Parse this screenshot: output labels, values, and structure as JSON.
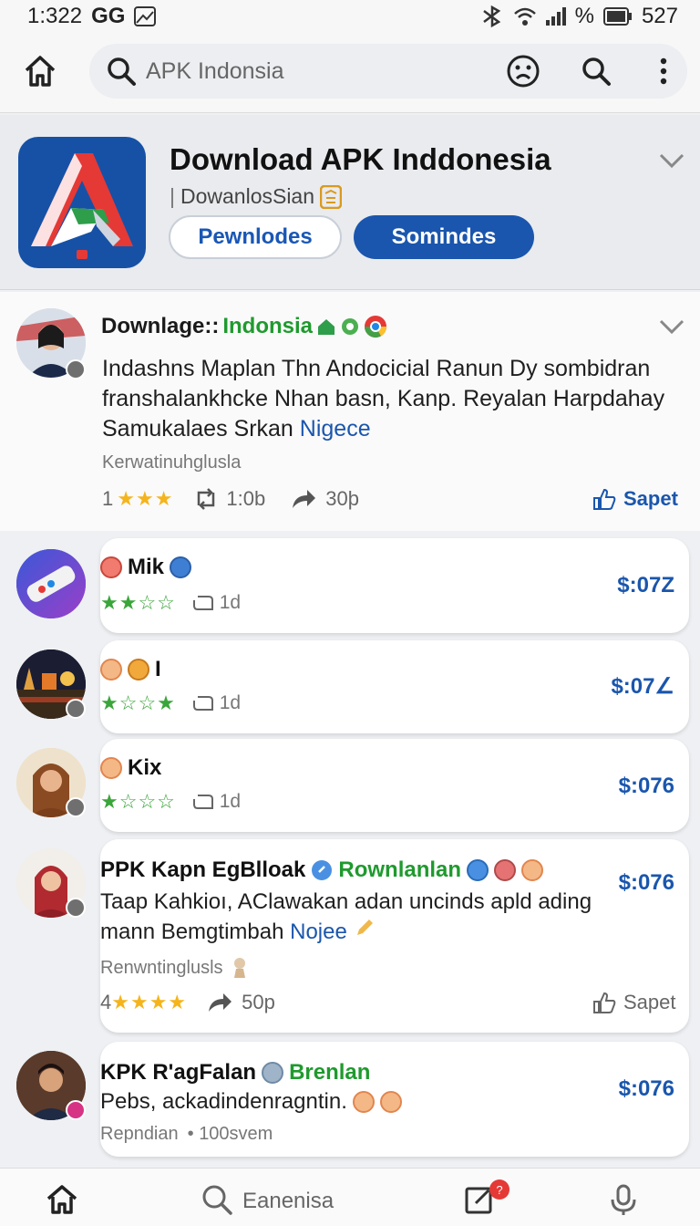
{
  "status_bar": {
    "time": "1:322",
    "carrier": "GG",
    "battery": "527",
    "signal_text": "%"
  },
  "search": {
    "placeholder": "APK Indonsia"
  },
  "app": {
    "title": "Download APK Inddonesia",
    "subtitle": "DowanlosSian",
    "btn_outline": "Pewnlodes",
    "btn_fill": "Somindes"
  },
  "post": {
    "author": "Downlage::",
    "author_tag": "Indonsia",
    "body_line1": "Indashns Maplan Thn Andocicial Ranun Dy sombidran",
    "body_line2": "franshalankhcke Nhan basn, Kanp. Reyalan Harpdahay",
    "body_line3": "Samukalaes Srkan",
    "body_link": "Nigece",
    "meta": "Kerwatinuhglusla",
    "rating_num": "1",
    "stars": "★★★",
    "reposts": "1:0b",
    "shares": "30þ",
    "save_label": "Sapet"
  },
  "cards": [
    {
      "name": "Mik",
      "stars": "★★☆☆",
      "time": "1d",
      "price": "$:07Z"
    },
    {
      "name": "I",
      "stars": "★☆☆★",
      "time": "1d",
      "price": "$:07∠"
    },
    {
      "name": "Kix",
      "stars": "★☆☆☆",
      "time": "1d",
      "price": "$:076"
    },
    {
      "name": "PPK Kapn EgBlloak",
      "tag": "Rownlanlan",
      "price": "$:076",
      "body_line1": "Taap Kahkioı, AClawakan adan uncinds apld ading",
      "body_line2": "mann Bemgtimbah",
      "body_link": "Nojee",
      "meta": "Renwntinglusls",
      "rating_num": "4",
      "stars": "★★★★",
      "shares": "50p",
      "save_label": "Sapet"
    },
    {
      "name": "KPK R'agFalan",
      "tag": "Brenlan",
      "price": "$:076",
      "body_line1": "Pebs, ackadindenragntin.",
      "meta": "Repndian",
      "meta2": "100svem"
    }
  ],
  "bottom_nav": {
    "search_label": "Eanenisa",
    "notif_count": "?"
  },
  "colors": {
    "accent": "#1a56ad",
    "green": "#1f9a2e",
    "star_gold": "#f5b41c",
    "star_red": "#e53935"
  }
}
